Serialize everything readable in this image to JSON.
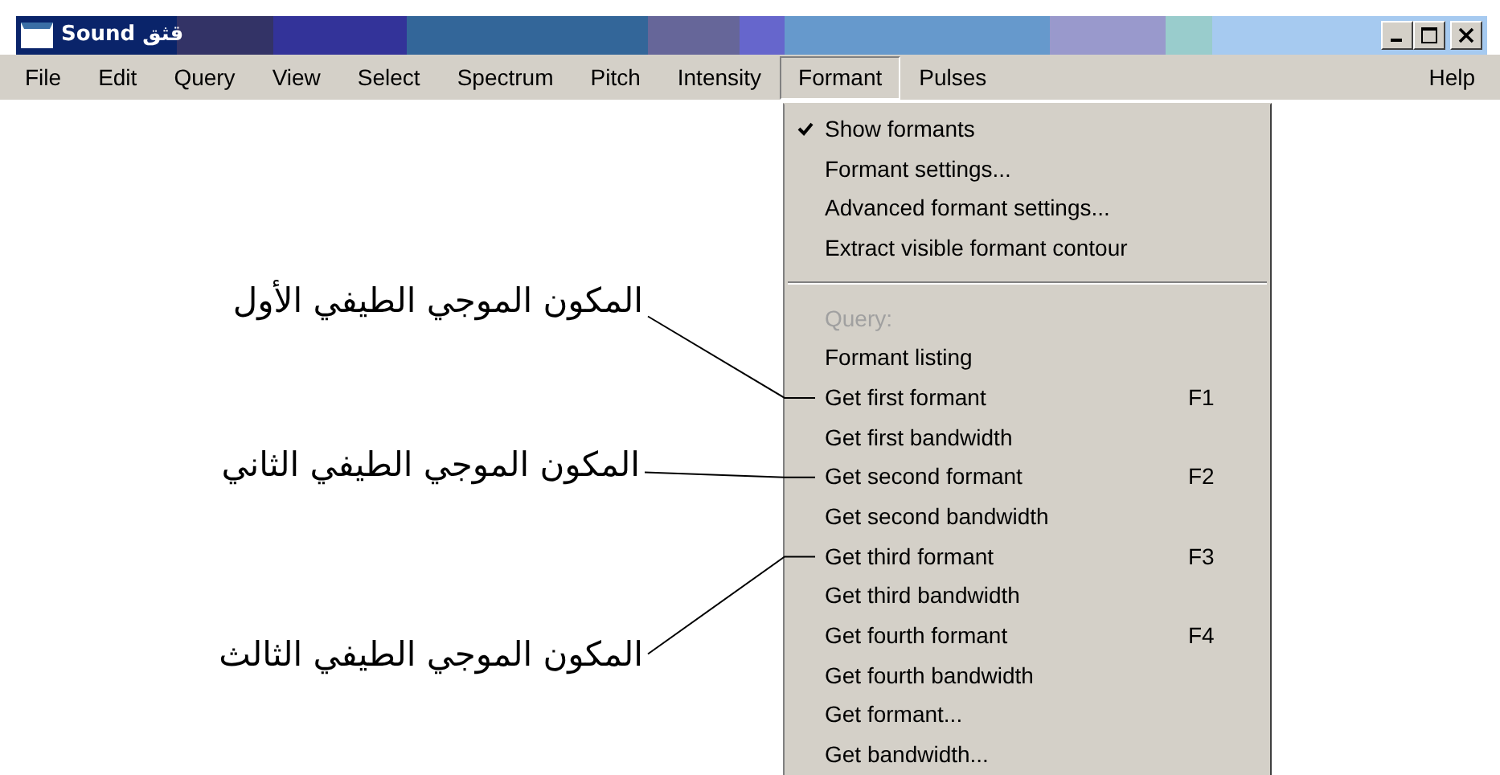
{
  "window": {
    "title": "Sound قثق"
  },
  "menubar": [
    {
      "label": "File",
      "selected": false
    },
    {
      "label": "Edit",
      "selected": false
    },
    {
      "label": "Query",
      "selected": false
    },
    {
      "label": "View",
      "selected": false
    },
    {
      "label": "Select",
      "selected": false
    },
    {
      "label": "Spectrum",
      "selected": false
    },
    {
      "label": "Pitch",
      "selected": false
    },
    {
      "label": "Intensity",
      "selected": false
    },
    {
      "label": "Formant",
      "selected": true
    },
    {
      "label": "Pulses",
      "selected": false
    },
    {
      "label": "Help",
      "selected": false
    }
  ],
  "dropdown": {
    "items": [
      {
        "kind": "item",
        "label": "Show formants",
        "checked": true
      },
      {
        "kind": "item",
        "label": "Formant settings...",
        "checked": false
      },
      {
        "kind": "item",
        "label": "Advanced formant settings...",
        "checked": false
      },
      {
        "kind": "item",
        "label": "Extract visible formant contour",
        "checked": false
      },
      {
        "kind": "separator"
      },
      {
        "kind": "header",
        "label": "Query:"
      },
      {
        "kind": "item",
        "label": "Formant listing",
        "checked": false
      },
      {
        "kind": "item",
        "label": "Get first formant",
        "shortcut": "F1",
        "checked": false
      },
      {
        "kind": "item",
        "label": "Get first bandwidth",
        "checked": false
      },
      {
        "kind": "item",
        "label": "Get second formant",
        "shortcut": "F2",
        "checked": false
      },
      {
        "kind": "item",
        "label": "Get second bandwidth",
        "checked": false
      },
      {
        "kind": "item",
        "label": "Get third formant",
        "shortcut": "F3",
        "checked": false
      },
      {
        "kind": "item",
        "label": "Get third bandwidth",
        "checked": false
      },
      {
        "kind": "item",
        "label": "Get fourth formant",
        "shortcut": "F4",
        "checked": false
      },
      {
        "kind": "item",
        "label": "Get fourth bandwidth",
        "checked": false
      },
      {
        "kind": "item",
        "label": "Get formant...",
        "checked": false
      },
      {
        "kind": "item",
        "label": "Get bandwidth...",
        "checked": false
      }
    ]
  },
  "annotations": [
    {
      "text": "المكون الموجي الطيفي الأول"
    },
    {
      "text": "المكون الموجي الطيفي الثاني"
    },
    {
      "text": "المكون الموجي الطيفي الثالث"
    }
  ]
}
